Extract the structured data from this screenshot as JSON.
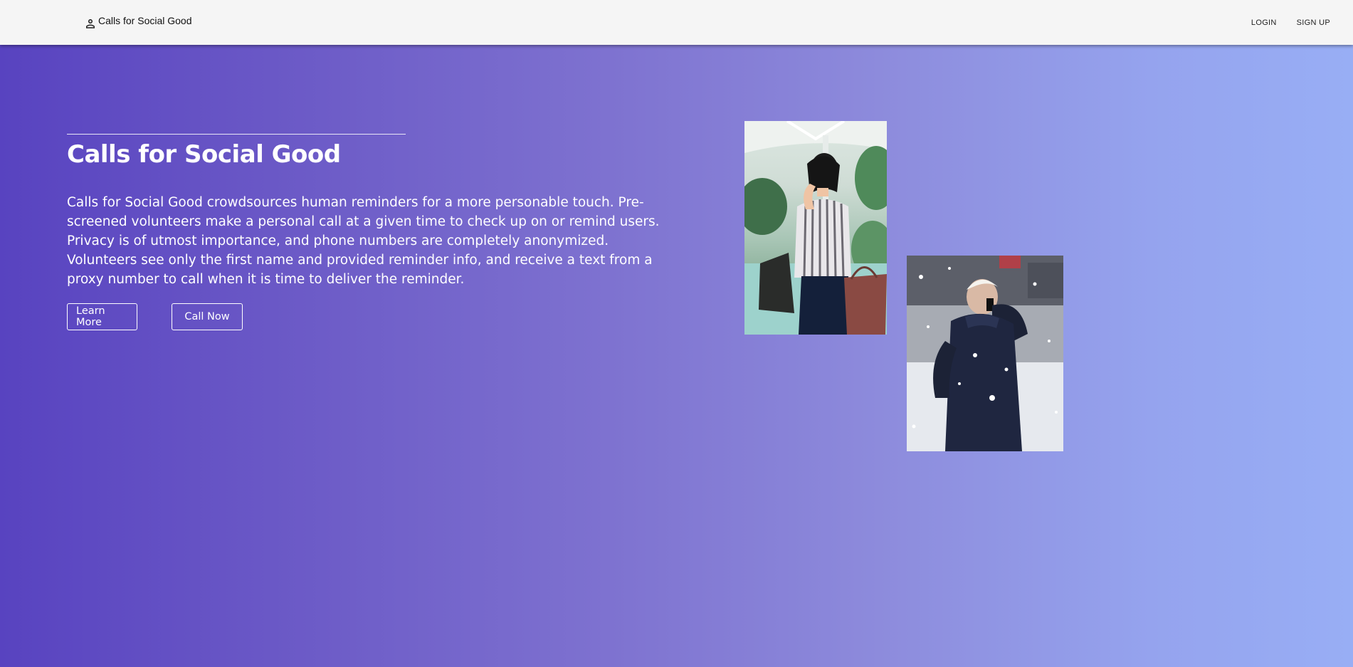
{
  "navbar": {
    "brand_icon": "person-icon",
    "brand_name": "Calls for Social Good",
    "links": [
      {
        "label": "LOGIN"
      },
      {
        "label": "SIGN UP"
      }
    ]
  },
  "hero": {
    "title": "Calls for Social Good",
    "description": "Calls for Social Good crowdsources human reminders for a more personable touch. Pre-screened volunteers make a personal call at a given time to check up on or remind users. Privacy is of utmost importance, and phone numbers are completely anonymized. Volunteers see only the first name and provided reminder info, and receive a text from a proxy number to call when it is time to deliver the reminder.",
    "buttons": {
      "learn_more": "Learn More",
      "call_now": "Call Now"
    }
  },
  "images": [
    {
      "subject": "woman-on-phone"
    },
    {
      "subject": "man-on-phone-in-snow"
    }
  ],
  "colors": {
    "gradient_start": "#5843c0",
    "gradient_end": "#98aef5",
    "navbar_bg": "#f5f5f5"
  }
}
